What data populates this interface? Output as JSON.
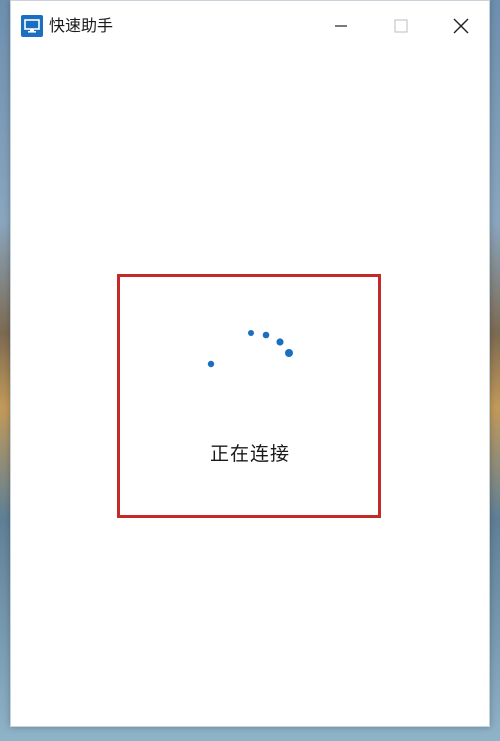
{
  "window": {
    "title": "快速助手"
  },
  "content": {
    "status": "正在连接"
  },
  "icons": {
    "app": "remote-assist-icon",
    "minimize": "minimize-icon",
    "maximize": "maximize-icon",
    "close": "close-icon",
    "spinner": "loading-spinner-icon"
  },
  "colors": {
    "accent": "#1a6fc0",
    "highlight_border": "#c52a2a"
  }
}
